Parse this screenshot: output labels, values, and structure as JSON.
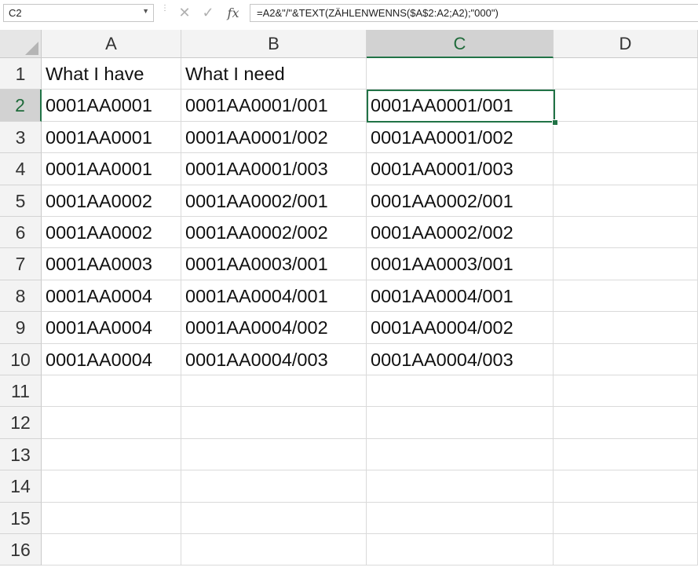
{
  "name_box": {
    "value": "C2"
  },
  "formula_bar": {
    "formula": "=A2&\"/\"&TEXT(ZÄHLENWENNS($A$2:A2;A2);\"000\")"
  },
  "columns": [
    "A",
    "B",
    "C",
    "D"
  ],
  "active_cell": {
    "column": "C",
    "row": 2
  },
  "rows": [
    {
      "num": "1",
      "cells": [
        "What I have",
        "What I need",
        "",
        ""
      ]
    },
    {
      "num": "2",
      "cells": [
        "0001AA0001",
        "0001AA0001/001",
        "0001AA0001/001",
        ""
      ]
    },
    {
      "num": "3",
      "cells": [
        "0001AA0001",
        "0001AA0001/002",
        "0001AA0001/002",
        ""
      ]
    },
    {
      "num": "4",
      "cells": [
        "0001AA0001",
        "0001AA0001/003",
        "0001AA0001/003",
        ""
      ]
    },
    {
      "num": "5",
      "cells": [
        "0001AA0002",
        "0001AA0002/001",
        "0001AA0002/001",
        ""
      ]
    },
    {
      "num": "6",
      "cells": [
        "0001AA0002",
        "0001AA0002/002",
        "0001AA0002/002",
        ""
      ]
    },
    {
      "num": "7",
      "cells": [
        "0001AA0003",
        "0001AA0003/001",
        "0001AA0003/001",
        ""
      ]
    },
    {
      "num": "8",
      "cells": [
        "0001AA0004",
        "0001AA0004/001",
        "0001AA0004/001",
        ""
      ]
    },
    {
      "num": "9",
      "cells": [
        "0001AA0004",
        "0001AA0004/002",
        "0001AA0004/002",
        ""
      ]
    },
    {
      "num": "10",
      "cells": [
        "0001AA0004",
        "0001AA0004/003",
        "0001AA0004/003",
        ""
      ]
    },
    {
      "num": "11",
      "cells": [
        "",
        "",
        "",
        ""
      ]
    },
    {
      "num": "12",
      "cells": [
        "",
        "",
        "",
        ""
      ]
    },
    {
      "num": "13",
      "cells": [
        "",
        "",
        "",
        ""
      ]
    },
    {
      "num": "14",
      "cells": [
        "",
        "",
        "",
        ""
      ]
    },
    {
      "num": "15",
      "cells": [
        "",
        "",
        "",
        ""
      ]
    },
    {
      "num": "16",
      "cells": [
        "",
        "",
        "",
        ""
      ]
    }
  ],
  "icons": {
    "cancel": "close-icon",
    "enter": "check-icon",
    "function": "fx-icon",
    "name_box_dropdown": "chevron-down-icon"
  },
  "colors": {
    "selection": "#217346",
    "header_bg": "#f3f3f3",
    "active_header_bg": "#d2d2d2"
  }
}
